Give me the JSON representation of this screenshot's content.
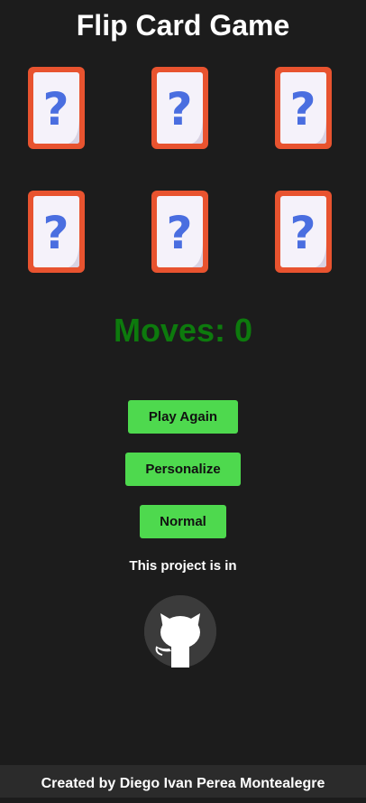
{
  "header": {
    "title": "Flip Card Game"
  },
  "cards": [
    {
      "face": "question-mark",
      "glyph": "?"
    },
    {
      "face": "question-mark",
      "glyph": "?"
    },
    {
      "face": "question-mark",
      "glyph": "?"
    },
    {
      "face": "question-mark",
      "glyph": "?"
    },
    {
      "face": "question-mark",
      "glyph": "?"
    },
    {
      "face": "question-mark",
      "glyph": "?"
    }
  ],
  "status": {
    "moves_label": "Moves:",
    "moves_value": "0"
  },
  "buttons": {
    "play_again": "Play Again",
    "personalize": "Personalize",
    "normal": "Normal"
  },
  "project": {
    "note": "This project is in",
    "icon": "github-icon"
  },
  "footer": {
    "credit": "Created by Diego Ivan Perea Montealegre"
  },
  "colors": {
    "background": "#1c1c1c",
    "card_border": "#e8532f",
    "card_face": "#f5f2fa",
    "question_mark": "#4a6ee0",
    "moves_text": "#0d7a0d",
    "button_bg": "#4ed94e",
    "footer_bg": "#2b2b2b"
  }
}
